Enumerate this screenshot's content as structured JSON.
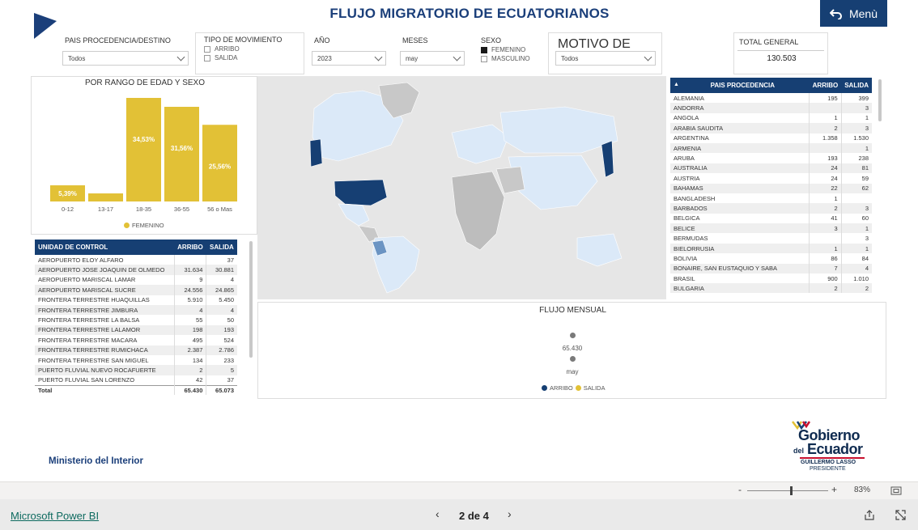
{
  "header": {
    "title": "FLUJO MIGRATORIO DE ECUATORIANOS",
    "menu_label": "Menù"
  },
  "filters": {
    "pais": {
      "label": "PAIS PROCEDENCIA/DESTINO",
      "value": "Todos"
    },
    "tipo": {
      "label": "TIPO DE MOVIMIENTO",
      "options": [
        "ARRIBO",
        "SALIDA"
      ]
    },
    "anio": {
      "label": "AÑO",
      "value": "2023"
    },
    "meses": {
      "label": "MESES",
      "value": "may"
    },
    "sexo": {
      "label": "SEXO",
      "options": [
        "FEMENINO",
        "MASCULINO"
      ],
      "selected": "FEMENINO"
    },
    "motivo": {
      "label": "MOTIVO DE VIAJE",
      "value": "Todos"
    },
    "total": {
      "label": "TOTAL GENERAL",
      "value": "130.503"
    }
  },
  "age_chart": {
    "title": "POR RANGO DE EDAD Y SEXO",
    "legend": "FEMENINO",
    "color": "#e2c136",
    "chart_data": {
      "type": "bar",
      "categories": [
        "0-12",
        "13-17",
        "18-35",
        "36-55",
        "56 o Mas"
      ],
      "values": [
        5.39,
        2.69,
        34.53,
        31.56,
        25.56
      ],
      "labels": [
        "5,39%",
        "",
        "34,53%",
        "31,56%",
        "25,56%"
      ]
    }
  },
  "unidad": {
    "headers": [
      "UNIDAD DE CONTROL",
      "ARRIBO",
      "SALIDA"
    ],
    "rows": [
      [
        "AEROPUERTO ELOY ALFARO",
        "",
        "37"
      ],
      [
        "AEROPUERTO JOSE JOAQUIN DE OLMEDO",
        "31.634",
        "30.881"
      ],
      [
        "AEROPUERTO MARISCAL LAMAR",
        "9",
        "4"
      ],
      [
        "AEROPUERTO MARISCAL SUCRE",
        "24.556",
        "24.865"
      ],
      [
        "FRONTERA TERRESTRE HUAQUILLAS",
        "5.910",
        "5.450"
      ],
      [
        "FRONTERA TERRESTRE JIMBURA",
        "4",
        "4"
      ],
      [
        "FRONTERA TERRESTRE LA BALSA",
        "55",
        "50"
      ],
      [
        "FRONTERA TERRESTRE LALAMOR",
        "198",
        "193"
      ],
      [
        "FRONTERA TERRESTRE MACARA",
        "495",
        "524"
      ],
      [
        "FRONTERA TERRESTRE RUMICHACA",
        "2.387",
        "2.786"
      ],
      [
        "FRONTERA TERRESTRE SAN MIGUEL",
        "134",
        "233"
      ],
      [
        "PUERTO FLUVIAL NUEVO ROCAFUERTE",
        "2",
        "5"
      ],
      [
        "PUERTO FLUVIAL SAN LORENZO",
        "42",
        "37"
      ]
    ],
    "total": [
      "Total",
      "65.430",
      "65.073"
    ]
  },
  "paises": {
    "headers": [
      "PAIS PROCEDENCIA",
      "ARRIBO",
      "SALIDA"
    ],
    "rows": [
      [
        "ALEMANIA",
        "195",
        "399"
      ],
      [
        "ANDORRA",
        "",
        "3"
      ],
      [
        "ANGOLA",
        "1",
        "1"
      ],
      [
        "ARABIA SAUDITA",
        "2",
        "3"
      ],
      [
        "ARGENTINA",
        "1.358",
        "1.530"
      ],
      [
        "ARMENIA",
        "",
        "1"
      ],
      [
        "ARUBA",
        "193",
        "238"
      ],
      [
        "AUSTRALIA",
        "24",
        "81"
      ],
      [
        "AUSTRIA",
        "24",
        "59"
      ],
      [
        "BAHAMAS",
        "22",
        "62"
      ],
      [
        "BANGLADESH",
        "1",
        ""
      ],
      [
        "BARBADOS",
        "2",
        "3"
      ],
      [
        "BELGICA",
        "41",
        "60"
      ],
      [
        "BELICE",
        "3",
        "1"
      ],
      [
        "BERMUDAS",
        "",
        "3"
      ],
      [
        "BIELORRUSIA",
        "1",
        "1"
      ],
      [
        "BOLIVIA",
        "86",
        "84"
      ],
      [
        "BONAIRE, SAN EUSTAQUIO Y SABA",
        "7",
        "4"
      ],
      [
        "BRASIL",
        "900",
        "1.010"
      ],
      [
        "BULGARIA",
        "2",
        "2"
      ]
    ]
  },
  "flujo": {
    "title": "FLUJO MENSUAL",
    "value_label": "65.430",
    "month_label": "may",
    "legend": [
      "ARRIBO",
      "SALIDA"
    ],
    "colors": [
      "#163f73",
      "#e2c136"
    ]
  },
  "brand": {
    "ministerio": "Ministerio del Interior",
    "gob1": "Gobierno",
    "gob2": "del",
    "gob3": "Ecuador",
    "gob4": "GUILLERMO LASSO",
    "gob5": "PRESIDENTE"
  },
  "zoom": {
    "value": "83%",
    "level": 0.83
  },
  "nav": {
    "app": "Microsoft Power BI",
    "page": "2 de 4"
  }
}
